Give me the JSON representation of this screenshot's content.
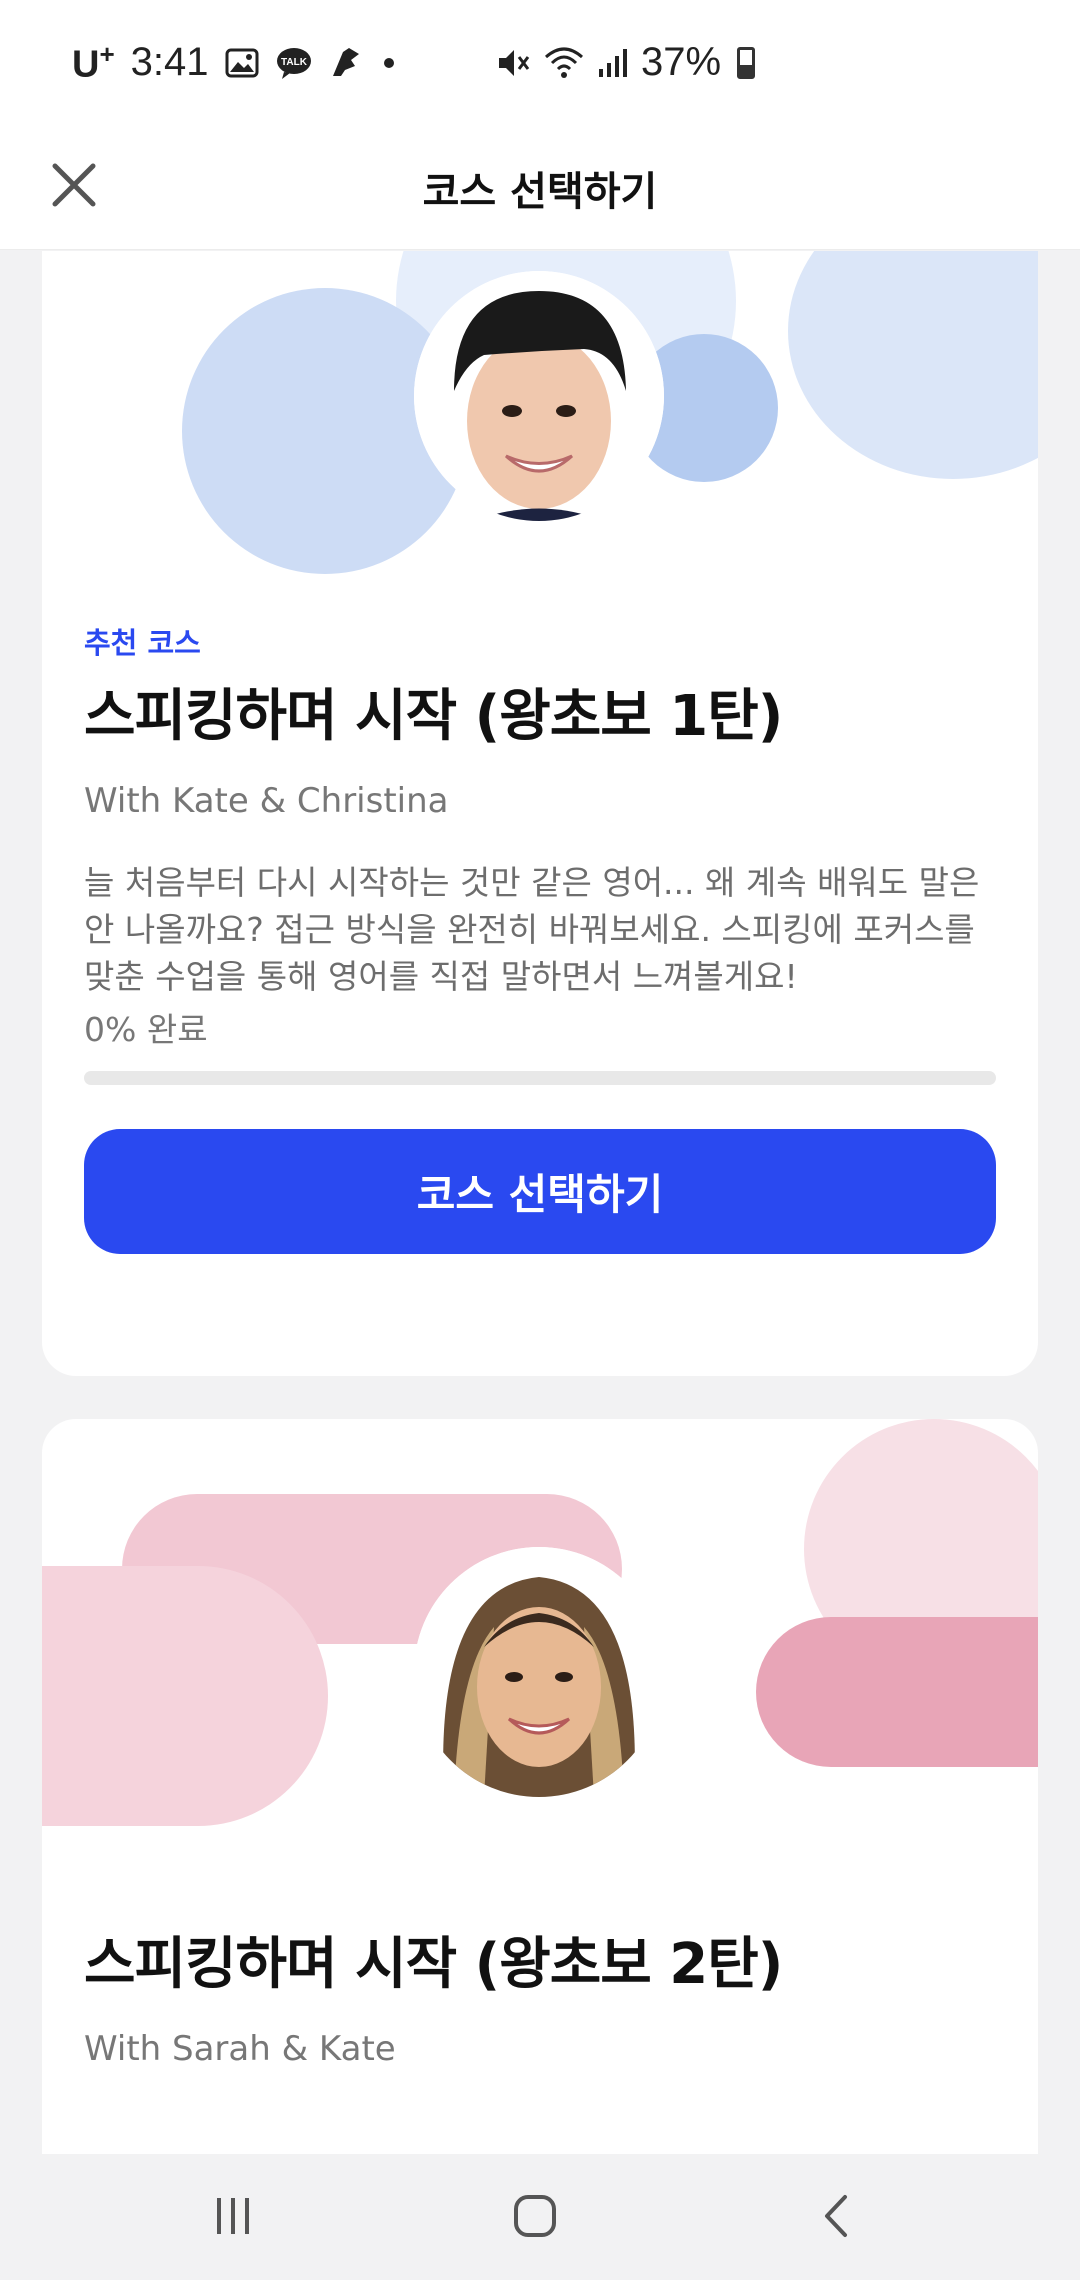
{
  "status_bar": {
    "carrier": "U",
    "carrier_plus": "+",
    "time": "3:41",
    "battery": "37%"
  },
  "header": {
    "title": "코스 선택하기"
  },
  "courses": [
    {
      "label": "추천 코스",
      "title": "스피킹하며 시작 (왕초보 1탄)",
      "teachers": "With Kate & Christina",
      "description": "늘 처음부터 다시 시작하는 것만 같은 영어... 왜 계속 배워도 말은 안 나올까요? 접근 방식을 완전히 바꿔보세요. 스피킹에 포커스를 맞춘 수업을 통해 영어를 직접 말하면서 느껴볼게요!",
      "progress_text": "0% 완료",
      "progress": 0,
      "button_label": "코스 선택하기",
      "accent_color": "#c9dbf5"
    },
    {
      "title": "스피킹하며 시작 (왕초보 2탄)",
      "teachers": "With Sarah & Kate",
      "accent_color": "#e8a5b7"
    }
  ],
  "colors": {
    "primary": "#2a49f0",
    "background": "#f2f2f3"
  },
  "icons": {
    "close": "close-icon",
    "nav_recent": "recent-apps-icon",
    "nav_home": "home-icon",
    "nav_back": "back-icon"
  }
}
